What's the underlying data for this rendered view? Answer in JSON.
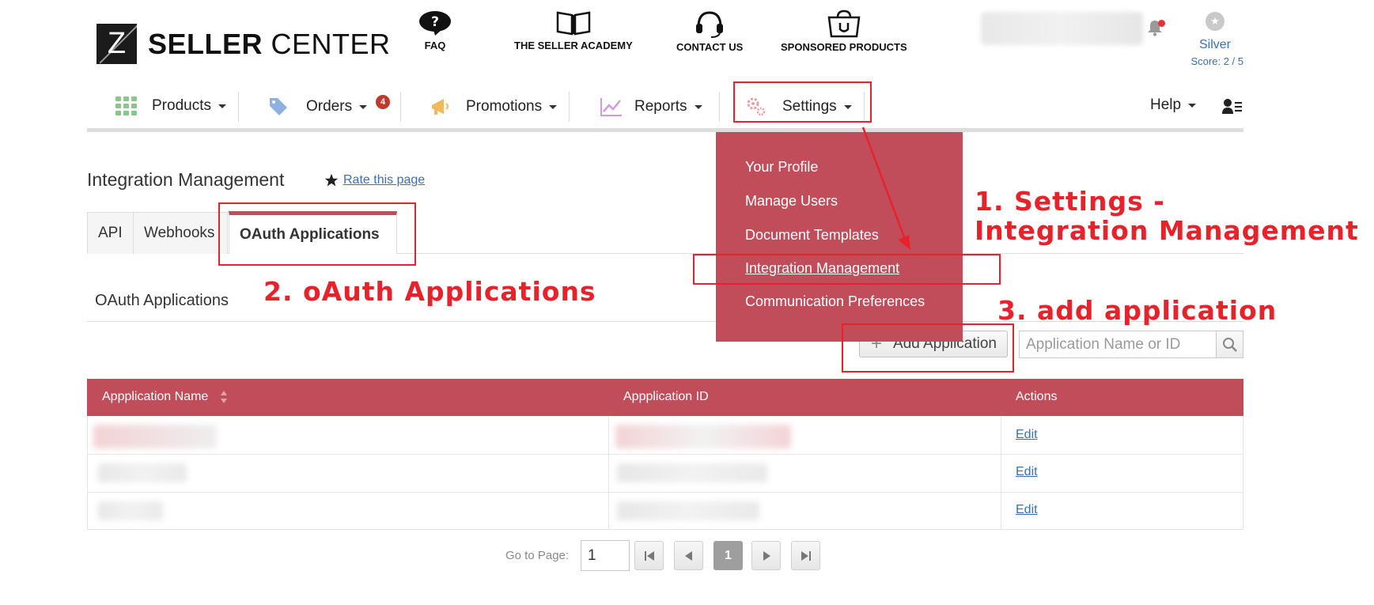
{
  "header": {
    "logo_letter": "Z",
    "logo_bold": "SELLER",
    "logo_light": "CENTER",
    "links": [
      {
        "label": "FAQ",
        "icon": "faq-bubble-icon"
      },
      {
        "label": "THE SELLER ACADEMY",
        "icon": "book-icon"
      },
      {
        "label": "CONTACT US",
        "icon": "headset-icon"
      },
      {
        "label": "SPONSORED PRODUCTS",
        "icon": "shopping-bag-icon"
      }
    ],
    "tier": "Silver",
    "score": "Score: 2 / 5"
  },
  "nav": {
    "products": "Products",
    "orders": "Orders",
    "orders_badge": "4",
    "promotions": "Promotions",
    "reports": "Reports",
    "settings": "Settings",
    "help": "Help"
  },
  "settings_menu": [
    "Your Profile",
    "Manage Users",
    "Document Templates",
    "Integration Management",
    "Communication Preferences"
  ],
  "page": {
    "title": "Integration Management",
    "rate_link": "Rate this page"
  },
  "tabs": [
    "API",
    "Webhooks",
    "OAuth Applications"
  ],
  "section_title": "OAuth Applications",
  "toolbar": {
    "add_label": "Add Application",
    "search_placeholder": "Application Name or ID"
  },
  "table": {
    "headers": [
      "Appplication Name",
      "Appplication ID",
      "Actions"
    ],
    "rows": [
      {
        "action": "Edit"
      },
      {
        "action": "Edit"
      },
      {
        "action": "Edit"
      }
    ]
  },
  "pager": {
    "label": "Go to Page:",
    "value": "1",
    "current": "1"
  },
  "annotations": {
    "step1_line1": "1. Settings -",
    "step1_line2": "Integration Management",
    "step2": "2. oAuth Applications",
    "step3": "3. add application"
  },
  "colors": {
    "brand": "#c24d5a",
    "annotation": "#e8222b",
    "link": "#3a6fb8"
  }
}
